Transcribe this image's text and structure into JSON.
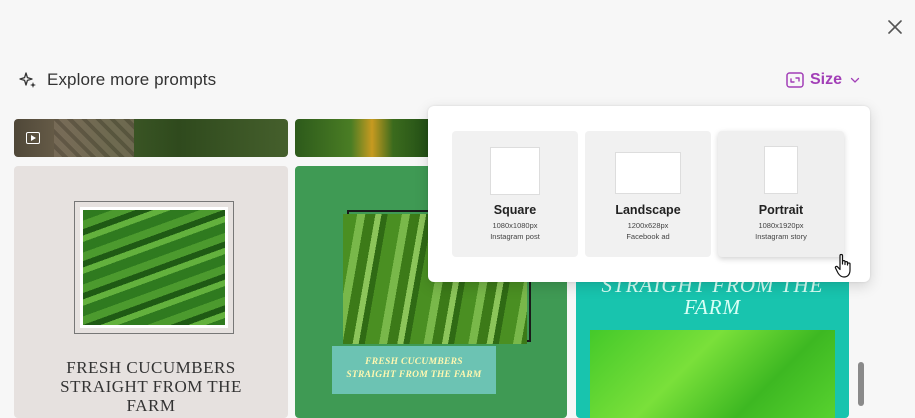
{
  "header": {
    "prompts_label": "Explore more prompts",
    "size_label": "Size"
  },
  "grid": {
    "card_fresh1_text": [
      "FRESH CUCUMBERS",
      "STRAIGHT FROM THE",
      "FARM"
    ],
    "card_fresh2_label": [
      "FRESH CUCUMBERS",
      "STRAIGHT FROM THE FARM"
    ],
    "card_farm_text": [
      "STRAIGHT FROM THE",
      "FARM"
    ]
  },
  "size_menu": {
    "options": [
      {
        "title": "Square",
        "dimensions": "1080x1080px",
        "subtitle": "Instagram post"
      },
      {
        "title": "Landscape",
        "dimensions": "1200x628px",
        "subtitle": "Facebook ad"
      },
      {
        "title": "Portrait",
        "dimensions": "1080x1920px",
        "subtitle": "Instagram story"
      }
    ]
  },
  "colors": {
    "accent": "#a23fb7",
    "background": "#f7f7f7"
  },
  "icons": [
    "close-icon",
    "sparkle-icon",
    "resize-frame-icon",
    "chevron-down-icon",
    "play-icon",
    "hand-pointer-cursor-icon"
  ]
}
